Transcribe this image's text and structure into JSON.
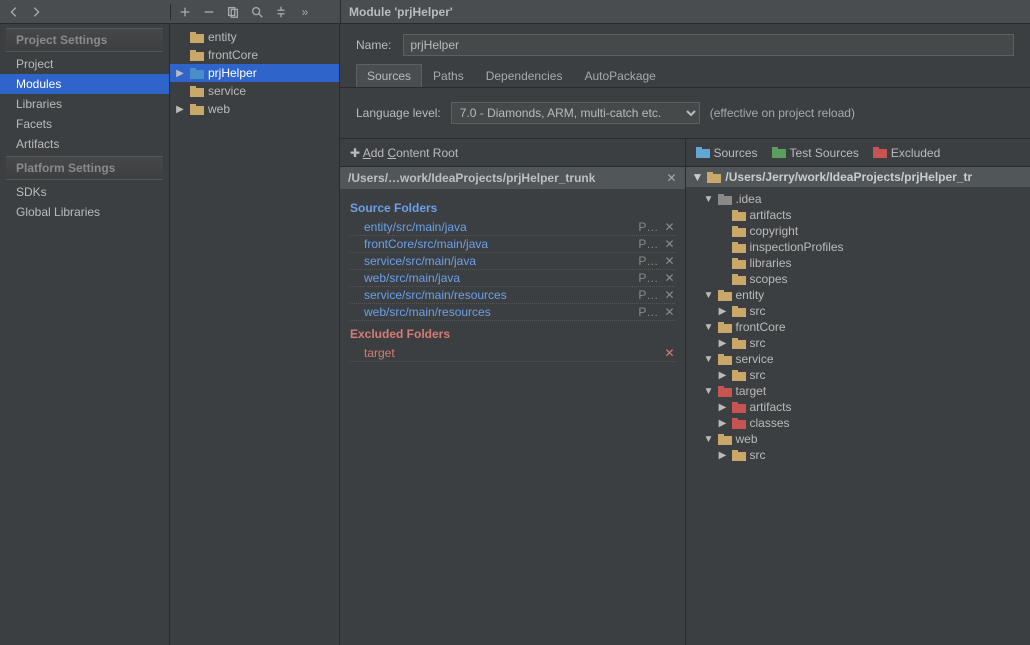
{
  "header": {
    "title": "Module 'prjHelper'"
  },
  "toolbar": {
    "plus": "+",
    "minus": "−",
    "copy": "⧉",
    "search": "🔍",
    "collapse": "⇕",
    "more": "»"
  },
  "projectSettings": {
    "hdr": "Project Settings",
    "items": [
      "Project",
      "Modules",
      "Libraries",
      "Facets",
      "Artifacts"
    ],
    "selectedIndex": 1
  },
  "platformSettings": {
    "hdr": "Platform Settings",
    "items": [
      "SDKs",
      "Global Libraries"
    ]
  },
  "modulesTree": {
    "items": [
      {
        "label": "entity",
        "expandable": false,
        "selected": false
      },
      {
        "label": "frontCore",
        "expandable": false,
        "selected": false
      },
      {
        "label": "prjHelper",
        "expandable": true,
        "selected": true
      },
      {
        "label": "service",
        "expandable": false,
        "selected": false
      },
      {
        "label": "web",
        "expandable": true,
        "selected": false
      }
    ]
  },
  "nameField": {
    "label": "Name:",
    "value": "prjHelper"
  },
  "tabs": {
    "items": [
      "Sources",
      "Paths",
      "Dependencies",
      "AutoPackage"
    ],
    "activeIndex": 0
  },
  "languageLevel": {
    "label": "Language level:",
    "value": "7.0 - Diamonds, ARM, multi-catch etc.",
    "hint": "(effective on project reload)"
  },
  "contentRoot": {
    "addLabel": "Add Content Root",
    "rootPath": "/Users/…work/IdeaProjects/prjHelper_trunk",
    "sourceFoldersTitle": "Source Folders",
    "sourceFolders": [
      "entity/src/main/java",
      "frontCore/src/main/java",
      "service/src/main/java",
      "web/src/main/java",
      "service/src/main/resources",
      "web/src/main/resources"
    ],
    "excludedFoldersTitle": "Excluded Folders",
    "excludedFolders": [
      "target"
    ]
  },
  "markAs": {
    "sources": "Sources",
    "testSources": "Test Sources",
    "excluded": "Excluded"
  },
  "dirTree": {
    "rootPath": "/Users/Jerry/work/IdeaProjects/prjHelper_tr",
    "nodes": [
      {
        "depth": 1,
        "label": ".idea",
        "arrow": "▼",
        "color": "grey"
      },
      {
        "depth": 2,
        "label": "artifacts",
        "arrow": "",
        "color": "tan"
      },
      {
        "depth": 2,
        "label": "copyright",
        "arrow": "",
        "color": "tan"
      },
      {
        "depth": 2,
        "label": "inspectionProfiles",
        "arrow": "",
        "color": "tan"
      },
      {
        "depth": 2,
        "label": "libraries",
        "arrow": "",
        "color": "tan"
      },
      {
        "depth": 2,
        "label": "scopes",
        "arrow": "",
        "color": "tan"
      },
      {
        "depth": 1,
        "label": "entity",
        "arrow": "▼",
        "color": "tan"
      },
      {
        "depth": 2,
        "label": "src",
        "arrow": "▶",
        "color": "tan"
      },
      {
        "depth": 1,
        "label": "frontCore",
        "arrow": "▼",
        "color": "tan"
      },
      {
        "depth": 2,
        "label": "src",
        "arrow": "▶",
        "color": "tan"
      },
      {
        "depth": 1,
        "label": "service",
        "arrow": "▼",
        "color": "tan"
      },
      {
        "depth": 2,
        "label": "src",
        "arrow": "▶",
        "color": "tan"
      },
      {
        "depth": 1,
        "label": "target",
        "arrow": "▼",
        "color": "red"
      },
      {
        "depth": 2,
        "label": "artifacts",
        "arrow": "▶",
        "color": "red"
      },
      {
        "depth": 2,
        "label": "classes",
        "arrow": "▶",
        "color": "red"
      },
      {
        "depth": 1,
        "label": "web",
        "arrow": "▼",
        "color": "tan"
      },
      {
        "depth": 2,
        "label": "src",
        "arrow": "▶",
        "color": "tan"
      }
    ]
  }
}
